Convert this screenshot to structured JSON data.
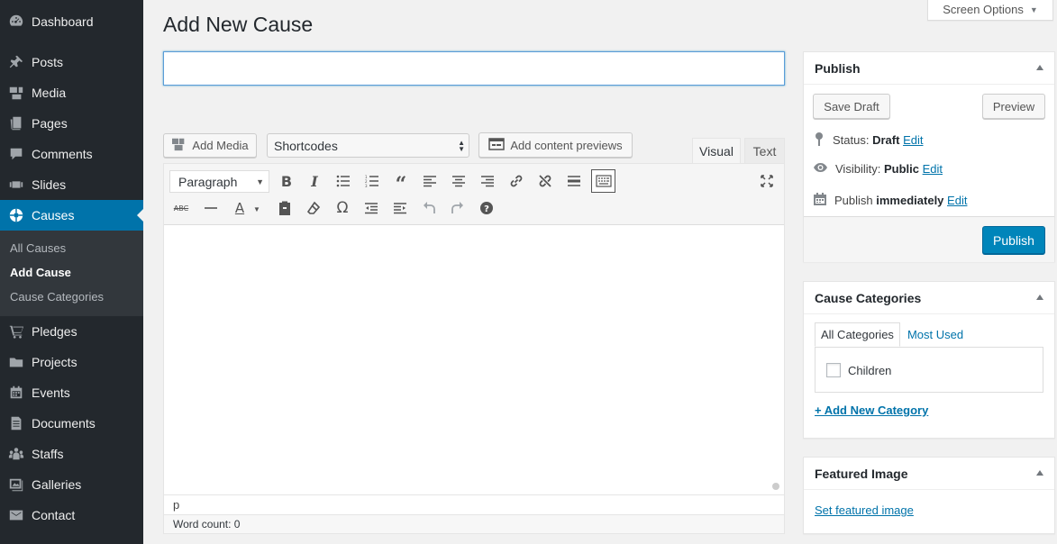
{
  "sidebar": {
    "items": [
      {
        "label": "Dashboard",
        "icon": "dashboard-icon"
      },
      {
        "label": "Posts",
        "icon": "pin-icon"
      },
      {
        "label": "Media",
        "icon": "media-icon"
      },
      {
        "label": "Pages",
        "icon": "pages-icon"
      },
      {
        "label": "Comments",
        "icon": "comments-icon"
      },
      {
        "label": "Slides",
        "icon": "slides-icon"
      },
      {
        "label": "Causes",
        "icon": "causes-icon",
        "active": true
      }
    ],
    "submenu": [
      "All Causes",
      "Add Cause",
      "Cause Categories"
    ],
    "items_after": [
      {
        "label": "Pledges",
        "icon": "cart-icon"
      },
      {
        "label": "Projects",
        "icon": "folder-icon"
      },
      {
        "label": "Events",
        "icon": "calendar-icon"
      },
      {
        "label": "Documents",
        "icon": "document-icon"
      },
      {
        "label": "Staffs",
        "icon": "groups-icon"
      },
      {
        "label": "Galleries",
        "icon": "gallery-icon"
      },
      {
        "label": "Contact",
        "icon": "email-icon"
      }
    ]
  },
  "screen_options": {
    "label": "Screen Options"
  },
  "page": {
    "title": "Add New Cause",
    "title_value": ""
  },
  "editor": {
    "add_media": "Add Media",
    "shortcodes": "Shortcodes",
    "content_previews": "Add content previews",
    "tab_visual": "Visual",
    "tab_text": "Text",
    "format": "Paragraph",
    "path": "p",
    "word_count": "Word count: 0"
  },
  "publish": {
    "title": "Publish",
    "save_draft": "Save Draft",
    "preview": "Preview",
    "status_label": "Status:",
    "status_value": "Draft",
    "visibility_label": "Visibility:",
    "visibility_value": "Public",
    "publish_label": "Publish",
    "publish_value": "immediately",
    "edit": "Edit",
    "publish_button": "Publish"
  },
  "categories": {
    "title": "Cause Categories",
    "tab_all": "All Categories",
    "tab_most_used": "Most Used",
    "items": [
      "Children"
    ],
    "add_new": "+ Add New Category"
  },
  "featured_image": {
    "title": "Featured Image",
    "link": "Set featured image"
  },
  "colors": {
    "sidebar_bg": "#23282d",
    "accent": "#0073aa",
    "primary_button": "#0085ba"
  }
}
